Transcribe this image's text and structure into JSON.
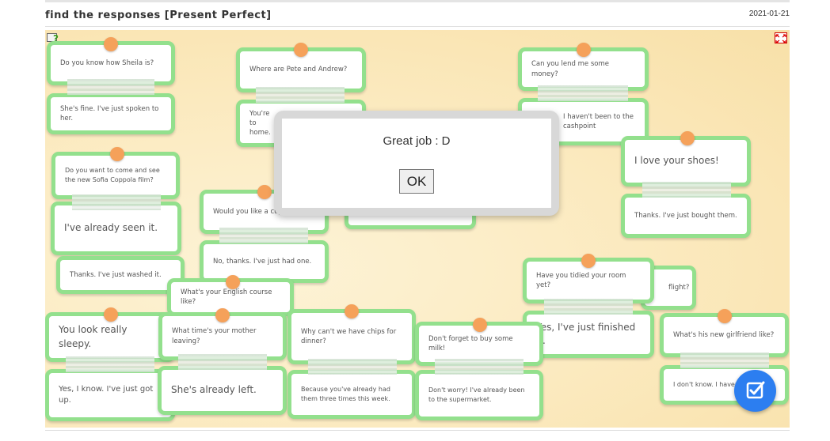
{
  "header": {
    "title": "find the responses [Present Perfect]",
    "date": "2021-01-21"
  },
  "cards": [
    "Do you know how Sheila is?",
    "She's fine. I've just spoken to her.",
    "Where are Pete and Andrew?",
    "You're to home.",
    "Can you lend me some money?",
    "I haven't been to the cashpoint",
    "I love your shoes!",
    "Thanks. I've just bought them.",
    "Do you want to come and see the new Sofia Coppola film?",
    "I've already seen it.",
    "Thanks. I've just washed it.",
    "Would you like a cup",
    "No, thanks. I've just had one.",
    "What's your English course like?",
    "Have you tidied your room yet?",
    "flight?",
    "Yes, I've just finished it.",
    "You look really sleepy.",
    "Yes, I know. I've just got up.",
    "What time's your mother leaving?",
    "She's already left.",
    "Why can't we have chips for dinner?",
    "Because you've already had them three times this week.",
    "Don't forget to buy some milk!",
    "Don't worry! I've already been to the supermarket.",
    "What's his new girlfriend like?",
    "I don't know. I haven't"
  ],
  "dialog": {
    "message": "Great job : D",
    "ok_label": "OK"
  },
  "icons": {
    "help": "help-icon",
    "expand": "expand-icon",
    "check": "check-icon"
  },
  "colors": {
    "card_border": "#93e08d",
    "pin": "#f5a15a",
    "check_button": "#2c7ef0",
    "board": "#fbe9bd"
  }
}
